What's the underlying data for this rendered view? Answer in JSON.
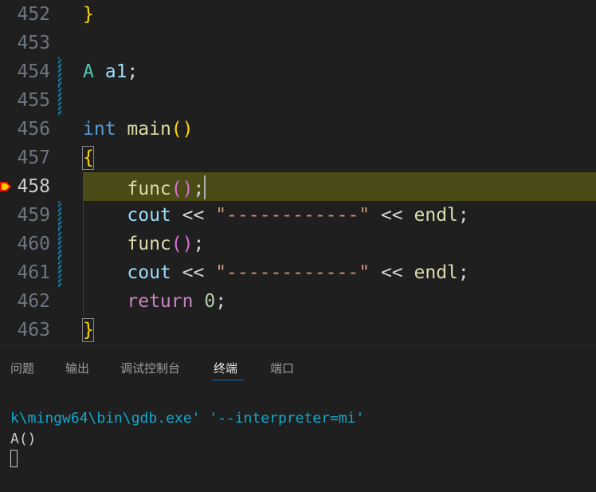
{
  "editor": {
    "lines": [
      {
        "num": "452"
      },
      {
        "num": "453"
      },
      {
        "num": "454"
      },
      {
        "num": "455"
      },
      {
        "num": "456"
      },
      {
        "num": "457"
      },
      {
        "num": "458"
      },
      {
        "num": "459"
      },
      {
        "num": "460"
      },
      {
        "num": "461"
      },
      {
        "num": "462"
      },
      {
        "num": "463"
      }
    ],
    "tokens": {
      "close_brace": "}",
      "type_A": "A",
      "var_a1": "a1",
      "semicolon": ";",
      "kw_int": "int",
      "fn_main": "main",
      "paren_open": "(",
      "paren_close": ")",
      "open_brace": "{",
      "fn_func": "func",
      "cout": "cout",
      "shift_op": "<<",
      "dash_string": "\"------------\"",
      "endl": "endl",
      "kw_return": "return",
      "zero": "0"
    }
  },
  "panel": {
    "tabs": [
      {
        "label": "问题"
      },
      {
        "label": "输出"
      },
      {
        "label": "调试控制台"
      },
      {
        "label": "终端"
      },
      {
        "label": "端口"
      }
    ],
    "active_tab": "终端"
  },
  "terminal": {
    "lines": [
      "k\\mingw64\\bin\\gdb.exe' '--interpreter=mi'",
      "A()"
    ]
  },
  "colors": {
    "background": "#1f1f1f",
    "current_line_highlight": "#4b4b18",
    "keyword_blue": "#569cd6",
    "keyword_purple": "#c586c0",
    "function": "#dcdcaa",
    "type": "#4ec9b0",
    "variable": "#9cdcfe",
    "string": "#ce9178",
    "number": "#b5cea8",
    "bracket_gold": "#ffd700",
    "bracket_orchid": "#da70d6",
    "terminal_cyan": "#11a8cd",
    "tab_active_underline": "#0078d4"
  }
}
